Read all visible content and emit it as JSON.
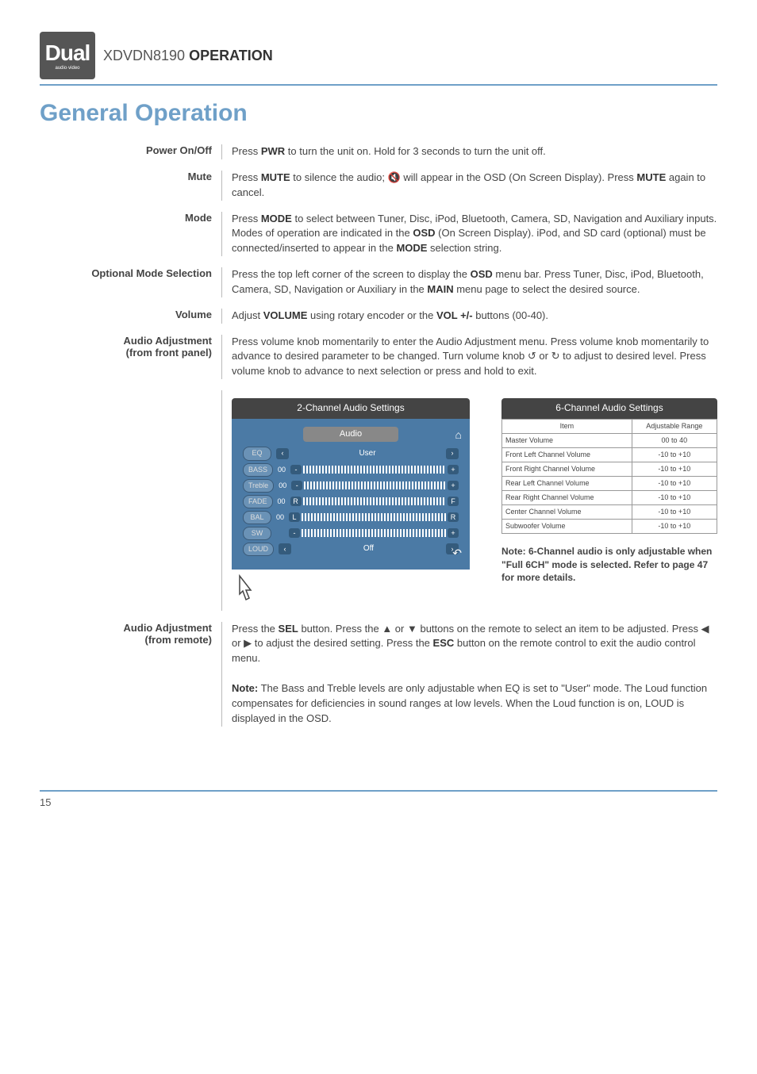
{
  "header": {
    "logo_main": "Dual",
    "logo_sub": "audio·video",
    "model": "XDVDN8190",
    "section": "OPERATION"
  },
  "page_heading": "General Operation",
  "rows": [
    {
      "label": "Power On/Off",
      "body_pre": "Press ",
      "b1": "PWR",
      "body_post": " to turn the unit on. Hold for 3 seconds to turn the unit off."
    },
    {
      "label": "Mute",
      "body_pre": "Press ",
      "b1": "MUTE",
      "body_mid": " to silence the audio; 🔇 will appear in the OSD (On Screen Display). Press ",
      "b2": "MUTE",
      "body_post": " again to cancel."
    },
    {
      "label": "Mode",
      "body_pre": "Press ",
      "b1": "MODE",
      "body_mid": " to select between Tuner, Disc, iPod, Bluetooth, Camera, SD, Navigation and Auxiliary inputs. Modes of operation are indicated in the ",
      "b2": "OSD",
      "body_mid2": " (On Screen Display). iPod, and SD card (optional) must be connected/inserted to appear in the ",
      "b3": "MODE",
      "body_post": " selection string."
    },
    {
      "label": "Optional Mode Selection",
      "body_pre": "Press the top left corner of the screen to display the ",
      "b1": "OSD",
      "body_mid": " menu bar. Press Tuner, Disc, iPod, Bluetooth, Camera, SD, Navigation or Auxiliary in the ",
      "b2": "MAIN",
      "body_post": " menu page to select the desired source."
    },
    {
      "label": "Volume",
      "body_pre": "Adjust ",
      "b1": "VOLUME",
      "body_mid": " using rotary encoder or the ",
      "b2": "VOL +/-",
      "body_post": " buttons (00-40)."
    },
    {
      "label": "Audio Adjustment\n(from front panel)",
      "body_plain": "Press volume knob momentarily to enter the Audio Adjustment menu. Press volume knob momentarily to advance to desired parameter to be changed. Turn volume knob ↺ or ↻ to adjust to desired level. Press volume knob to advance to next selection or press and hold to exit."
    }
  ],
  "two_ch_title": "2-Channel Audio Settings",
  "panel": {
    "inner_title": "Audio",
    "rows": [
      {
        "pill": "EQ",
        "type": "arrows",
        "value": "User"
      },
      {
        "pill": "BASS",
        "type": "slider",
        "num": "00",
        "l": "-",
        "r": "+"
      },
      {
        "pill": "Treble",
        "type": "slider",
        "num": "00",
        "l": "-",
        "r": "+"
      },
      {
        "pill": "FADE",
        "type": "slider",
        "num": "00",
        "l": "R",
        "r": "F"
      },
      {
        "pill": "BAL",
        "type": "slider",
        "num": "00",
        "l": "L",
        "r": "R"
      },
      {
        "pill": "SW",
        "type": "slider",
        "num": "",
        "l": "-",
        "r": "+"
      },
      {
        "pill": "LOUD",
        "type": "arrows",
        "value": "Off"
      }
    ]
  },
  "six_ch_title": "6-Channel Audio Settings",
  "table": {
    "head": [
      "Item",
      "Adjustable Range"
    ],
    "rows": [
      [
        "Master Volume",
        "00 to 40"
      ],
      [
        "Front Left Channel Volume",
        "-10 to +10"
      ],
      [
        "Front Right Channel Volume",
        "-10 to +10"
      ],
      [
        "Rear Left Channel Volume",
        "-10 to +10"
      ],
      [
        "Rear Right Channel Volume",
        "-10 to +10"
      ],
      [
        "Center Channel Volume",
        "-10 to +10"
      ],
      [
        "Subwoofer Volume",
        "-10 to +10"
      ]
    ]
  },
  "six_ch_note": "Note: 6-Channel audio is only adjustable when \"Full 6CH\" mode is selected. Refer to page 47 for more details.",
  "remote_row": {
    "label": "Audio Adjustment\n(from remote)",
    "p1_pre": "Press the ",
    "p1_b1": "SEL",
    "p1_mid": " button. Press the ▲ or ▼ buttons on the remote to select an item to be adjusted. Press ◀ or ▶ to adjust the desired setting. Press the ",
    "p1_b2": "ESC",
    "p1_post": " button on the remote control to exit the audio control menu.",
    "p2_pre": "",
    "p2_b1": "Note:",
    "p2_post": " The Bass and Treble levels are only adjustable when EQ is set to \"User\" mode. The Loud function compensates for deficiencies in sound ranges at low levels. When the Loud function is on, LOUD is displayed in the OSD."
  },
  "page_num": "15"
}
